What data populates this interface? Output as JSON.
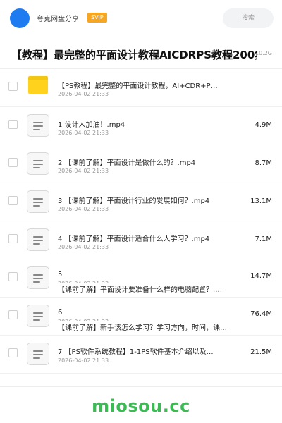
{
  "header": {
    "username": "夸克网盘分享",
    "badge": "SVIP",
    "search_placeholder": "搜索"
  },
  "share": {
    "title": "【教程】最完整的平面设计教程AICDRPS教程200集",
    "total_size": "10.2G"
  },
  "files": [
    {
      "type": "folder",
      "name": "【PS教程】最完整的平面设计教程，AI+CDR+P…",
      "date": "2026-04-02 21:33",
      "size": ""
    },
    {
      "type": "file",
      "name": "1 设计人加油！.mp4",
      "date": "2026-04-02 21:33",
      "size": "4.9M"
    },
    {
      "type": "file",
      "name": "2 【课前了解】平面设计是做什么的？.mp4",
      "date": "2026-04-02 21:33",
      "size": "8.7M"
    },
    {
      "type": "file",
      "name": "3 【课前了解】平面设计行业的发展如何？.mp4",
      "date": "2026-04-02 21:33",
      "size": "13.1M"
    },
    {
      "type": "file",
      "name": "4 【课前了解】平面设计适合什么人学习？.mp4",
      "date": "2026-04-02 21:33",
      "size": "7.1M"
    },
    {
      "type": "file",
      "name": "5",
      "name2": "【课前了解】平面设计要准备什么样的电脑配置？.…",
      "date": "2026-04-02 21:33",
      "size": "14.7M"
    },
    {
      "type": "file",
      "name": "6",
      "name2": "【课前了解】新手该怎么学习？学习方向，时间，课…",
      "date": "2026-04-02 21:33",
      "size": "76.4M"
    },
    {
      "type": "file",
      "name": "7 【PS软件系统教程】1-1PS软件基本介绍以及…",
      "date": "2026-04-02 21:33",
      "size": "21.5M"
    }
  ],
  "watermark": "miosou.cc"
}
